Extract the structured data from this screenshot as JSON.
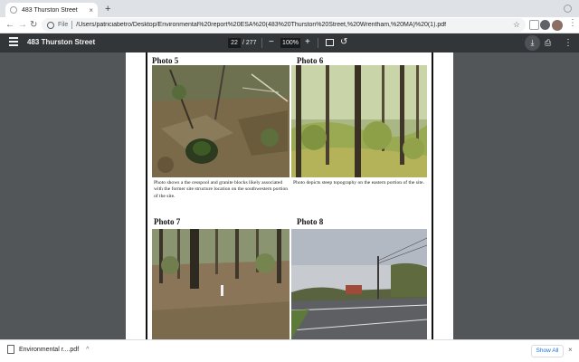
{
  "browser": {
    "tab_title": "483 Thurston Street",
    "tab_close": "×",
    "new_tab": "+",
    "url_scheme": "File",
    "url": "/Users/patriciabetro/Desktop/Environmental%20report%20ESA%20(483%20Thurston%20Street,%20Wrentham,%20MA)%20(1).pdf",
    "back": "←",
    "forward": "→",
    "reload": "↻",
    "bookmark_star": "☆",
    "menu": "⋮"
  },
  "pdf_toolbar": {
    "doc_title": "483 Thurston Street",
    "current_page": "22",
    "total_pages": "/ 277",
    "zoom": "100%",
    "zoom_out": "−",
    "zoom_in": "+",
    "rotate": "↺",
    "download": "⤓",
    "print": "⎙",
    "more": "⋮"
  },
  "page": {
    "photos": [
      {
        "label": "Photo 5",
        "caption": "Photo shows a the cesspool and granite blocks likely associated with the former site structure location on the southwestern portion of the site."
      },
      {
        "label": "Photo 6",
        "caption": "Photo depicts steep topography on the eastern portion of the site."
      },
      {
        "label": "Photo 7",
        "caption": ""
      },
      {
        "label": "Photo 8",
        "caption": ""
      }
    ]
  },
  "downloads": {
    "file_name": "Environmental r....pdf",
    "chevron": "^",
    "show_all": "Show All",
    "close": "×"
  },
  "colors": {
    "chrome_tabstrip": "#dee1e6",
    "pdf_toolbar": "#323639",
    "viewer_bg": "#525659",
    "accent": "#1a73e8"
  },
  "icons": [
    "page-favicon-icon",
    "back-arrow-icon",
    "forward-arrow-icon",
    "reload-icon",
    "info-icon",
    "star-icon",
    "hamburger-menu-icon",
    "fit-page-icon",
    "rotate-icon",
    "download-icon",
    "print-icon",
    "more-vert-icon",
    "pdf-file-icon"
  ]
}
